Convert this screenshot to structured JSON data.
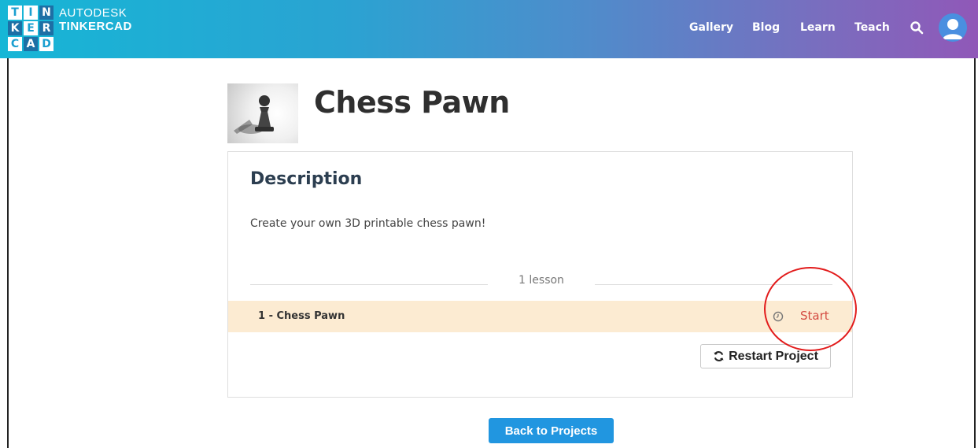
{
  "header": {
    "logo_letters": [
      "T",
      "I",
      "N",
      "K",
      "E",
      "R",
      "C",
      "A",
      "D"
    ],
    "brand": "AUTODESK",
    "product": "TINKERCAD",
    "nav": [
      "Gallery",
      "Blog",
      "Learn",
      "Teach"
    ],
    "search_icon": "search-icon",
    "avatar_icon": "user-avatar"
  },
  "project": {
    "title": "Chess Pawn",
    "thumbnail_icon": "chess-pawn-image"
  },
  "description": {
    "heading": "Description",
    "text": "Create your own 3D printable chess pawn!"
  },
  "lessons": {
    "count_label": "1 lesson",
    "items": [
      {
        "name": "1 - Chess Pawn",
        "action": "Start",
        "status_icon": "clock-icon"
      }
    ]
  },
  "buttons": {
    "restart": "Restart Project",
    "back": "Back to Projects"
  },
  "colors": {
    "lesson_row_bg": "#fcebd2",
    "start_link": "#d44b42",
    "back_button": "#2196e0",
    "annotation": "#e21b1b"
  }
}
